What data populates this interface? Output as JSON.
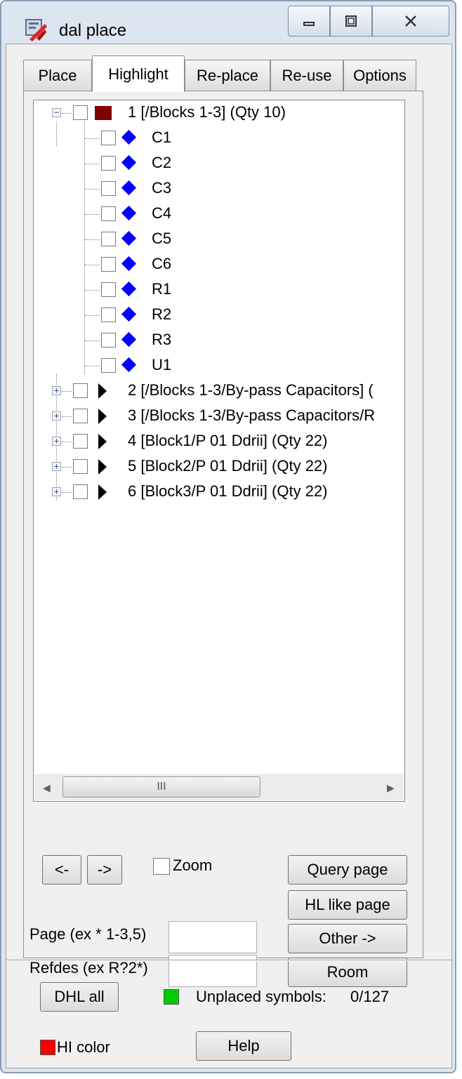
{
  "window": {
    "title": "dal place",
    "min_icon": "minimize-icon",
    "max_icon": "maximize-icon",
    "close_icon": "close-icon"
  },
  "tabs": [
    {
      "label": "Place",
      "active": false
    },
    {
      "label": "Highlight",
      "active": true
    },
    {
      "label": "Re-place",
      "active": false
    },
    {
      "label": "Re-use",
      "active": false
    },
    {
      "label": "Options",
      "active": false
    }
  ],
  "tree": {
    "group1": {
      "label": "1 [/Blocks 1-3] (Qty 10)",
      "color": "#800000",
      "expanded": true,
      "children": [
        "C1",
        "C2",
        "C3",
        "C4",
        "C5",
        "C6",
        "R1",
        "R2",
        "R3",
        "U1"
      ],
      "child_marker_color": "#0000ff"
    },
    "collapsed_groups": [
      "2 [/Blocks 1-3/By-pass Capacitors] (",
      "3 [/Blocks 1-3/By-pass Capacitors/R",
      "4 [Block1/P 01 Ddrii] (Qty 22)",
      "5 [Block2/P 01 Ddrii] (Qty 22)",
      "6 [Block3/P 01 Ddrii] (Qty 22)"
    ],
    "scroll_grip": "III"
  },
  "controls": {
    "prev_label": "<-",
    "next_label": "->",
    "zoom_label": "Zoom",
    "zoom_checked": false,
    "query_page_label": "Query page",
    "hl_like_page_label": "HL like page",
    "other_label": "Other ->",
    "room_label": "Room",
    "page_label": "Page (ex * 1-3,5)",
    "page_value": "",
    "refdes_label": "Refdes (ex R?2*)",
    "refdes_value": ""
  },
  "footer": {
    "dhl_all_label": "DHL all",
    "unplaced_label": "Unplaced symbols:",
    "unplaced_value": "0/127",
    "unplaced_color": "#00cc00",
    "hl_color_label": "HI color",
    "hl_color": "#ff0000",
    "help_label": "Help"
  }
}
